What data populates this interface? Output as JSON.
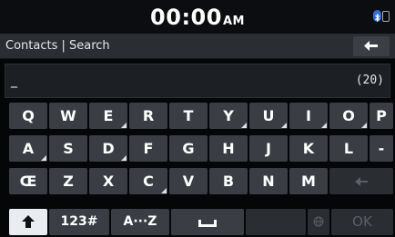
{
  "status_bar": {
    "time": "00:00",
    "ampm": "AM",
    "icons": [
      "bluetooth-icon",
      "phone-icon"
    ]
  },
  "header": {
    "title": "Contacts | Search",
    "back_icon": "back-arrow-icon"
  },
  "input": {
    "value": "_",
    "char_count": "(20)"
  },
  "keyboard": {
    "row1": [
      "Q",
      "W",
      "E",
      "R",
      "T",
      "Y",
      "U",
      "I",
      "O",
      "P"
    ],
    "row2": [
      "A",
      "S",
      "D",
      "F",
      "G",
      "H",
      "J",
      "K",
      "L",
      "-"
    ],
    "row3": [
      "Œ",
      "Z",
      "X",
      "C",
      "V",
      "B",
      "N",
      "M"
    ],
    "backspace_icon": "backspace-icon",
    "bottom": {
      "shift_icon": "shift-up-arrow-icon",
      "num_label": "123#",
      "az_label": "A···Z",
      "space_icon": "space-icon",
      "globe_icon": "globe-icon",
      "ok_label": "OK"
    }
  }
}
